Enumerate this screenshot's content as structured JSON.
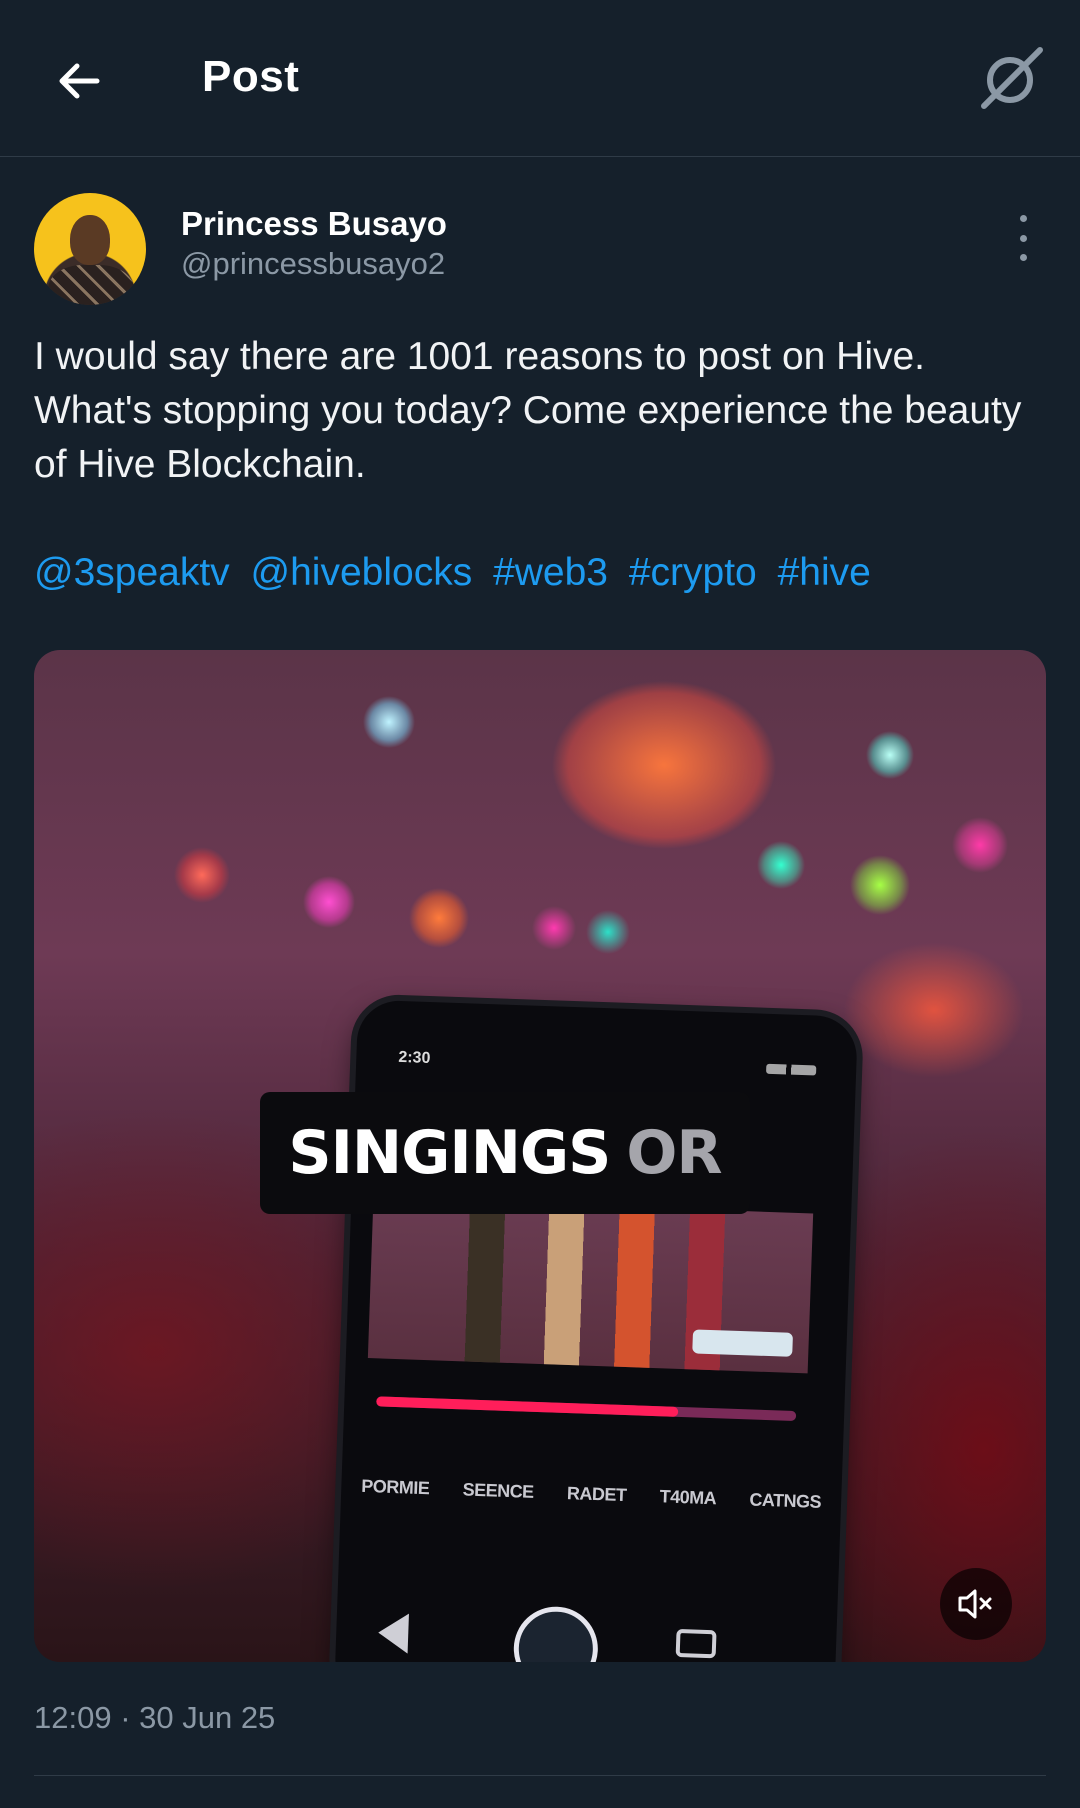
{
  "header": {
    "title": "Post",
    "back_icon": "arrow-left-icon",
    "grok_icon": "grok-icon"
  },
  "author": {
    "name": "Princess Busayo",
    "handle": "@princessbusayo2"
  },
  "post": {
    "text": "I would say there are 1001 reasons to post on Hive. What's stopping you today? Come experience the beauty of Hive Blockchain.",
    "links": [
      "@3speaktv",
      "@hiveblocks",
      "#web3",
      "#crypto",
      "#hive"
    ],
    "link_color": "#1d9bf0"
  },
  "media": {
    "caption_main": "SINGINGS",
    "caption_sub": "OR",
    "phone_time": "2:30",
    "phone_menu": [
      "PORMIE",
      "SEENCE",
      "RADET",
      "T40MA",
      "CATNGS"
    ],
    "video_progress": 0.72,
    "muted": true,
    "mute_icon": "speaker-muted-icon"
  },
  "meta": {
    "timestamp": "12:09 · 30 Jun 25"
  },
  "colors": {
    "background": "#15202b",
    "secondary_text": "#8b98a5",
    "divider": "#2f3b47"
  }
}
